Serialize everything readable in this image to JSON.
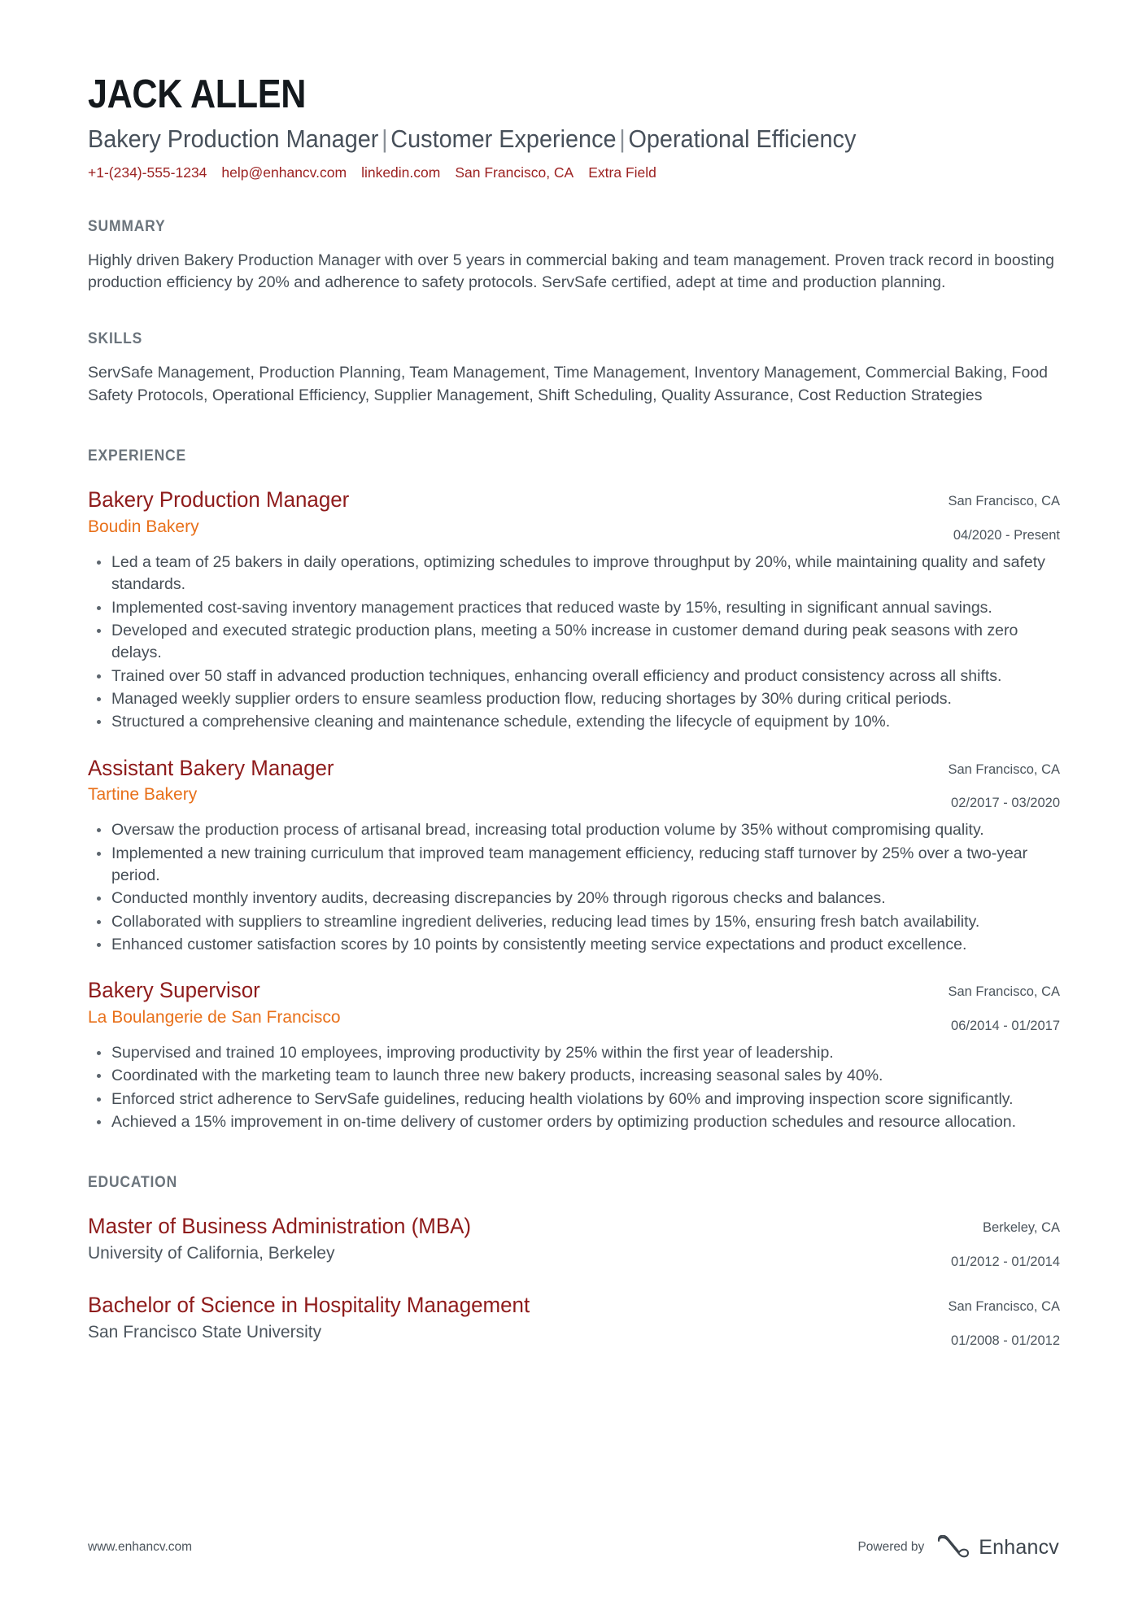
{
  "header": {
    "name": "JACK ALLEN",
    "title_parts": [
      "Bakery Production Manager",
      "Customer Experience",
      "Operational Efficiency"
    ],
    "separator": "|",
    "accent_color": "#9c2222",
    "contacts": [
      "+1-(234)-555-1234",
      "help@enhancv.com",
      "linkedin.com",
      "San Francisco, CA",
      "Extra Field"
    ]
  },
  "summary": {
    "heading": "SUMMARY",
    "text": "Highly driven Bakery Production Manager with over 5 years in commercial baking and team management. Proven track record in boosting production efficiency by 20% and adherence to safety protocols. ServSafe certified, adept at time and production planning."
  },
  "skills": {
    "heading": "SKILLS",
    "text": "ServSafe Management, Production Planning, Team Management, Time Management, Inventory Management, Commercial Baking, Food Safety Protocols, Operational Efficiency, Supplier Management, Shift Scheduling, Quality Assurance, Cost Reduction Strategies"
  },
  "experience": {
    "heading": "EXPERIENCE",
    "entries": [
      {
        "title": "Bakery Production Manager",
        "org": "Boudin Bakery",
        "location": "San Francisco, CA",
        "dates": "04/2020 - Present",
        "bullets": [
          "Led a team of 25 bakers in daily operations, optimizing schedules to improve throughput by 20%, while maintaining quality and safety standards.",
          "Implemented cost-saving inventory management practices that reduced waste by 15%, resulting in significant annual savings.",
          "Developed and executed strategic production plans, meeting a 50% increase in customer demand during peak seasons with zero delays.",
          "Trained over 50 staff in advanced production techniques, enhancing overall efficiency and product consistency across all shifts.",
          "Managed weekly supplier orders to ensure seamless production flow, reducing shortages by 30% during critical periods.",
          "Structured a comprehensive cleaning and maintenance schedule, extending the lifecycle of equipment by 10%."
        ]
      },
      {
        "title": "Assistant Bakery Manager",
        "org": "Tartine Bakery",
        "location": "San Francisco, CA",
        "dates": "02/2017 - 03/2020",
        "bullets": [
          "Oversaw the production process of artisanal bread, increasing total production volume by 35% without compromising quality.",
          "Implemented a new training curriculum that improved team management efficiency, reducing staff turnover by 25% over a two-year period.",
          "Conducted monthly inventory audits, decreasing discrepancies by 20% through rigorous checks and balances.",
          "Collaborated with suppliers to streamline ingredient deliveries, reducing lead times by 15%, ensuring fresh batch availability.",
          "Enhanced customer satisfaction scores by 10 points by consistently meeting service expectations and product excellence."
        ]
      },
      {
        "title": "Bakery Supervisor",
        "org": "La Boulangerie de San Francisco",
        "location": "San Francisco, CA",
        "dates": "06/2014 - 01/2017",
        "bullets": [
          "Supervised and trained 10 employees, improving productivity by 25% within the first year of leadership.",
          "Coordinated with the marketing team to launch three new bakery products, increasing seasonal sales by 40%.",
          "Enforced strict adherence to ServSafe guidelines, reducing health violations by 60% and improving inspection score significantly.",
          "Achieved a 15% improvement in on-time delivery of customer orders by optimizing production schedules and resource allocation."
        ]
      }
    ]
  },
  "education": {
    "heading": "EDUCATION",
    "entries": [
      {
        "title": "Master of Business Administration (MBA)",
        "org": "University of California, Berkeley",
        "location": "Berkeley, CA",
        "dates": "01/2012 - 01/2014"
      },
      {
        "title": "Bachelor of Science in Hospitality Management",
        "org": "San Francisco State University",
        "location": "San Francisco, CA",
        "dates": "01/2008 - 01/2012"
      }
    ]
  },
  "footer": {
    "url": "www.enhancv.com",
    "powered_by": "Powered by",
    "brand": "Enhancv"
  }
}
